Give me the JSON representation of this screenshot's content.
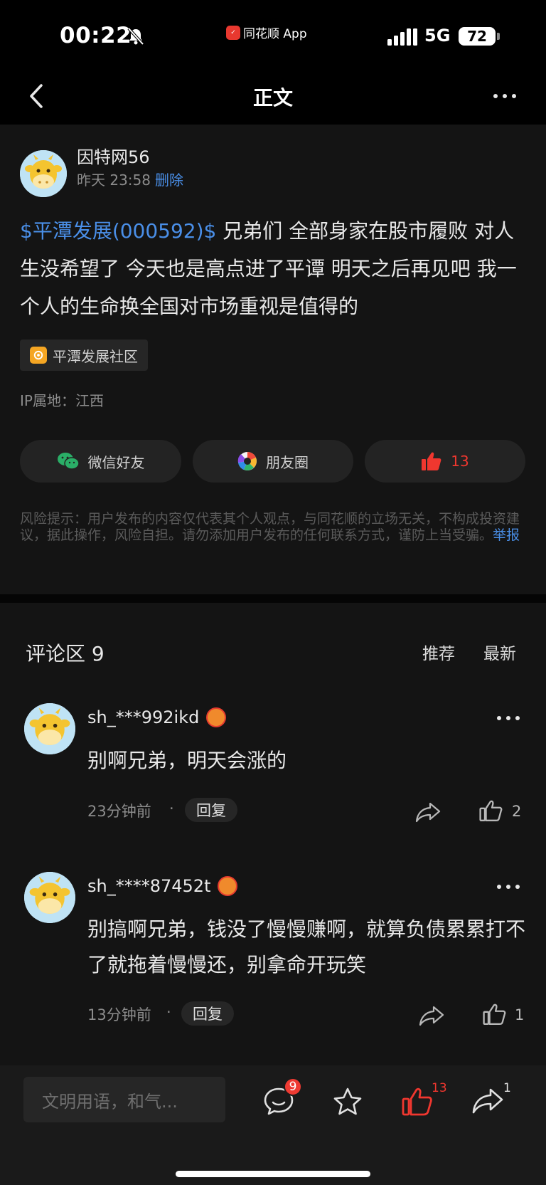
{
  "status_bar": {
    "time": "00:22",
    "app_label": "同花顺 App",
    "network": "5G",
    "battery": "72"
  },
  "nav": {
    "title": "正文"
  },
  "post": {
    "username": "因特网56",
    "timestamp": "昨天 23:58",
    "delete_label": "删除",
    "stock_tag": "$平潭发展(000592)$",
    "content": "兄弟们 全部身家在股市履败 对人生没希望了 今天也是高点进了平谭 明天之后再见吧 我一个人的生命换全国对市场重视是值得的",
    "community": "平潭发展社区",
    "ip_location": "IP属地：江西",
    "share_wechat": "微信好友",
    "share_moments": "朋友圈",
    "like_count": "13",
    "risk_notice": "风险提示：用户发布的内容仅代表其个人观点，与同花顺的立场无关，不构成投资建议，据此操作，风险自担。请勿添加用户发布的任何联系方式，谨防上当受骗。",
    "report_label": "举报"
  },
  "comments": {
    "title": "评论区 9",
    "sort_recommended": "推荐",
    "sort_latest": "最新",
    "items": [
      {
        "username": "sh_***992ikd",
        "text": "别啊兄弟，明天会涨的",
        "time": "23分钟前",
        "reply_label": "回复",
        "like_count": "2"
      },
      {
        "username": "sh_****87452t",
        "text": "别搞啊兄弟，钱没了慢慢赚啊，就算负债累累打不了就拖着慢慢还，别拿命开玩笑",
        "time": "13分钟前",
        "reply_label": "回复",
        "like_count": "1"
      }
    ],
    "separator": "·"
  },
  "bottom_bar": {
    "input_placeholder": "文明用语，和气...",
    "comment_badge": "9",
    "like_count": "13",
    "share_count": "1"
  },
  "colors": {
    "link_blue": "#4a8fe8",
    "like_red": "#f0372f",
    "background": "#141414"
  }
}
